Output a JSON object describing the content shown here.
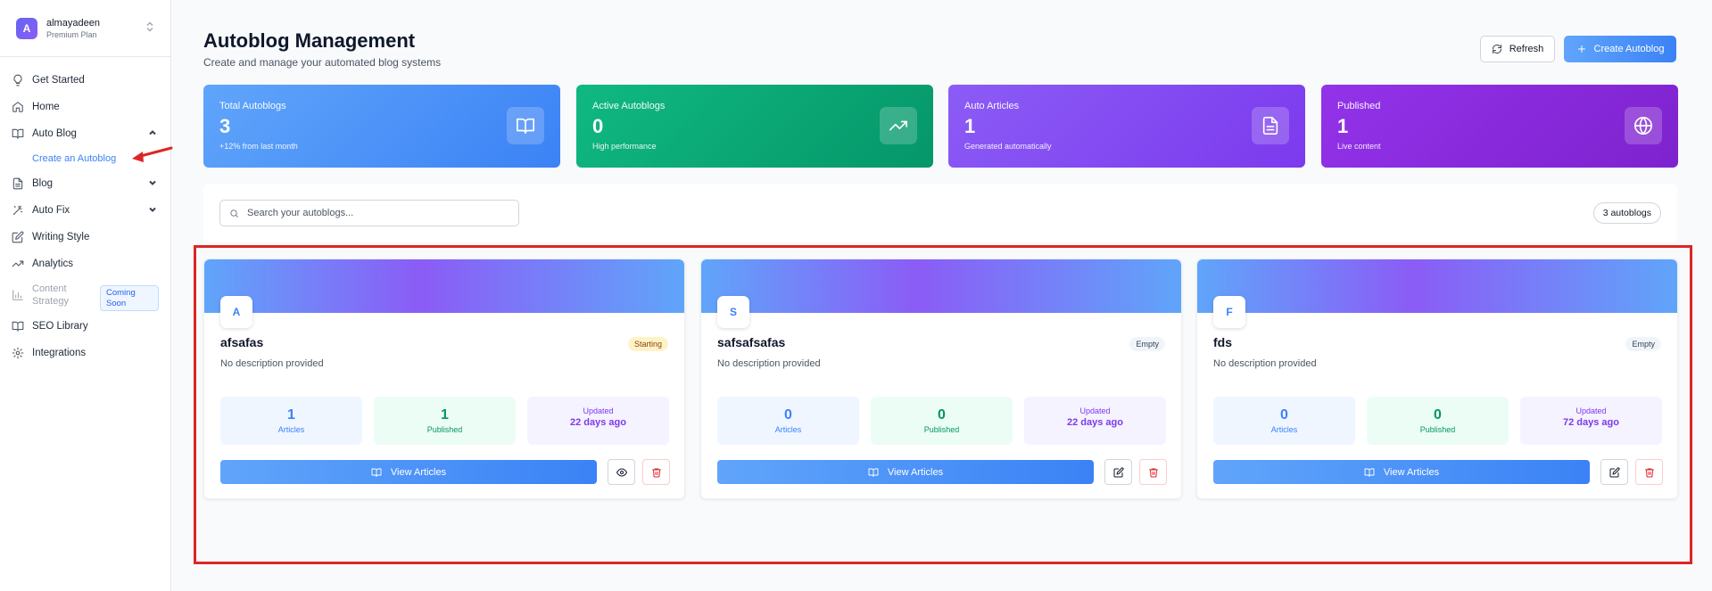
{
  "account": {
    "initial": "A",
    "name": "almayadeen",
    "plan": "Premium Plan"
  },
  "nav": {
    "get_started": "Get Started",
    "home": "Home",
    "auto_blog": "Auto Blog",
    "create_autoblog": "Create an Autoblog",
    "blog": "Blog",
    "auto_fix": "Auto Fix",
    "writing_style": "Writing Style",
    "analytics": "Analytics",
    "content_strategy": "Content Strategy",
    "coming_soon": "Coming Soon",
    "seo_library": "SEO Library",
    "integrations": "Integrations"
  },
  "header": {
    "title": "Autoblog Management",
    "subtitle": "Create and manage your automated blog systems",
    "refresh_label": "Refresh",
    "create_label": "Create Autoblog"
  },
  "stats": [
    {
      "label": "Total Autoblogs",
      "value": "3",
      "note": "+12% from last month",
      "icon": "book-open-icon",
      "color": "#3b82f6"
    },
    {
      "label": "Active Autoblogs",
      "value": "0",
      "note": "High performance",
      "icon": "trending-up-icon",
      "color": "#10b981"
    },
    {
      "label": "Auto Articles",
      "value": "1",
      "note": "Generated automatically",
      "icon": "file-text-icon",
      "color": "#8b5cf6"
    },
    {
      "label": "Published",
      "value": "1",
      "note": "Live content",
      "icon": "globe-icon",
      "color": "#9333ea"
    }
  ],
  "search": {
    "placeholder": "Search your autoblogs...",
    "count": "3 autoblogs"
  },
  "cards": [
    {
      "initial": "A",
      "name": "afsafas",
      "status": "Starting",
      "description": "No description provided",
      "articles": "1",
      "articles_label": "Articles",
      "published": "1",
      "published_label": "Published",
      "updated_label": "Updated",
      "updated": "22 days ago",
      "view_label": "View Articles"
    },
    {
      "initial": "S",
      "name": "safsafsafas",
      "status": "Empty",
      "description": "No description provided",
      "articles": "0",
      "articles_label": "Articles",
      "published": "0",
      "published_label": "Published",
      "updated_label": "Updated",
      "updated": "22 days ago",
      "view_label": "View Articles"
    },
    {
      "initial": "F",
      "name": "fds",
      "status": "Empty",
      "description": "No description provided",
      "articles": "0",
      "articles_label": "Articles",
      "published": "0",
      "published_label": "Published",
      "updated_label": "Updated",
      "updated": "72 days ago",
      "view_label": "View Articles"
    }
  ],
  "colors": {
    "accent": "#3b82f6",
    "highlight": "#dc2626",
    "danger": "#dc2626"
  }
}
